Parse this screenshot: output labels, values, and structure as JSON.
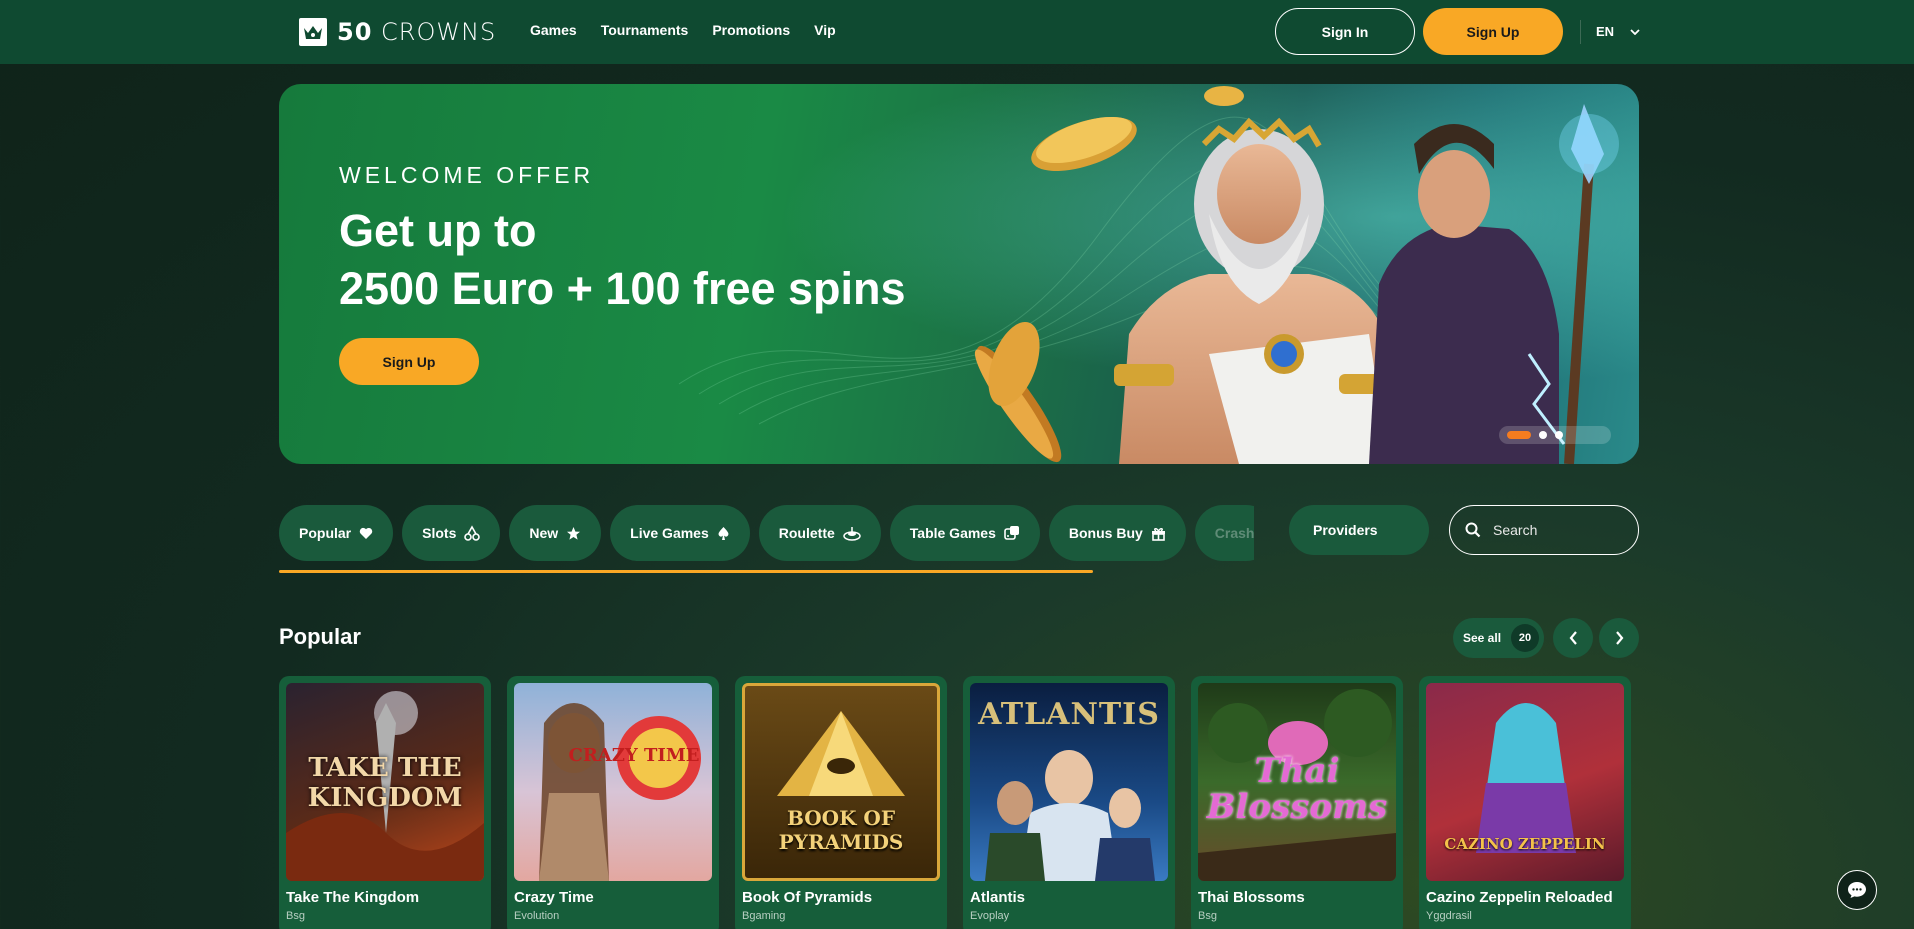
{
  "header": {
    "logo": {
      "bold": "50",
      "text": " CROWNS"
    },
    "nav": [
      {
        "label": "Games",
        "name": "nav-games"
      },
      {
        "label": "Tournaments",
        "name": "nav-tournaments"
      },
      {
        "label": "Promotions",
        "name": "nav-promotions"
      },
      {
        "label": "Vip",
        "name": "nav-vip"
      }
    ],
    "sign_in": "Sign In",
    "sign_up": "Sign Up",
    "language": "EN"
  },
  "banner": {
    "kicker": "WELCOME OFFER",
    "title_line1": "Get up to",
    "title_line2": "2500 Euro + 100 free spins",
    "cta": "Sign Up",
    "slides": 3,
    "active_slide": 1
  },
  "categories": [
    {
      "label": "Popular",
      "icon": "heart-icon"
    },
    {
      "label": "Slots",
      "icon": "cherries-icon"
    },
    {
      "label": "New",
      "icon": "star-icon"
    },
    {
      "label": "Live Games",
      "icon": "spade-icon"
    },
    {
      "label": "Roulette",
      "icon": "roulette-icon"
    },
    {
      "label": "Table Games",
      "icon": "dice-icon"
    },
    {
      "label": "Bonus Buy",
      "icon": "gift-icon"
    },
    {
      "label": "Crash",
      "icon": "rocket-icon"
    }
  ],
  "providers_label": "Providers",
  "search": {
    "placeholder": "Search"
  },
  "popular": {
    "title": "Popular",
    "see_all": "See all",
    "count": "20",
    "games": [
      {
        "name": "Take The Kingdom",
        "provider": "Bsg",
        "art": "TAKE THE KINGDOM",
        "colors": [
          "#3b2a1c",
          "#a8421c"
        ]
      },
      {
        "name": "Crazy Time",
        "provider": "Evolution",
        "art": "CRAZY TIME",
        "colors": [
          "#8fb2d8",
          "#e8b7b8"
        ]
      },
      {
        "name": "Book Of Pyramids",
        "provider": "Bgaming",
        "art": "BOOK OF PYRAMIDS",
        "colors": [
          "#5a3a12",
          "#c28a28"
        ]
      },
      {
        "name": "Atlantis",
        "provider": "Evoplay",
        "art": "ATLANTIS",
        "colors": [
          "#0e2c5a",
          "#2b6aa8"
        ]
      },
      {
        "name": "Thai Blossoms",
        "provider": "Bsg",
        "art": "Thai Blossoms",
        "colors": [
          "#244a1c",
          "#6a8a3a"
        ]
      },
      {
        "name": "Cazino Zeppelin Reloaded",
        "provider": "Yggdrasil",
        "art": "CAZINO ZEPPELIN",
        "colors": [
          "#6a1a3a",
          "#c23a4a"
        ]
      }
    ]
  }
}
